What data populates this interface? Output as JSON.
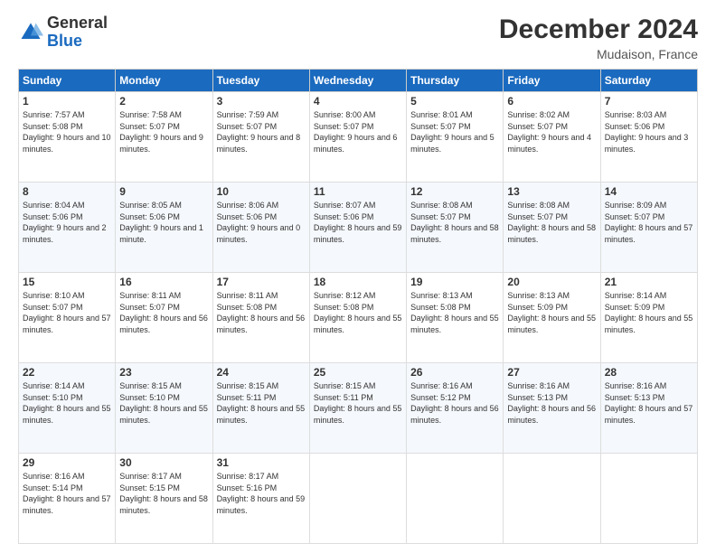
{
  "logo": {
    "general": "General",
    "blue": "Blue"
  },
  "title": "December 2024",
  "location": "Mudaison, France",
  "weekdays": [
    "Sunday",
    "Monday",
    "Tuesday",
    "Wednesday",
    "Thursday",
    "Friday",
    "Saturday"
  ],
  "weeks": [
    [
      {
        "day": "1",
        "sunrise": "7:57 AM",
        "sunset": "5:08 PM",
        "daylight": "9 hours and 10 minutes."
      },
      {
        "day": "2",
        "sunrise": "7:58 AM",
        "sunset": "5:07 PM",
        "daylight": "9 hours and 9 minutes."
      },
      {
        "day": "3",
        "sunrise": "7:59 AM",
        "sunset": "5:07 PM",
        "daylight": "9 hours and 8 minutes."
      },
      {
        "day": "4",
        "sunrise": "8:00 AM",
        "sunset": "5:07 PM",
        "daylight": "9 hours and 6 minutes."
      },
      {
        "day": "5",
        "sunrise": "8:01 AM",
        "sunset": "5:07 PM",
        "daylight": "9 hours and 5 minutes."
      },
      {
        "day": "6",
        "sunrise": "8:02 AM",
        "sunset": "5:07 PM",
        "daylight": "9 hours and 4 minutes."
      },
      {
        "day": "7",
        "sunrise": "8:03 AM",
        "sunset": "5:06 PM",
        "daylight": "9 hours and 3 minutes."
      }
    ],
    [
      {
        "day": "8",
        "sunrise": "8:04 AM",
        "sunset": "5:06 PM",
        "daylight": "9 hours and 2 minutes."
      },
      {
        "day": "9",
        "sunrise": "8:05 AM",
        "sunset": "5:06 PM",
        "daylight": "9 hours and 1 minute."
      },
      {
        "day": "10",
        "sunrise": "8:06 AM",
        "sunset": "5:06 PM",
        "daylight": "9 hours and 0 minutes."
      },
      {
        "day": "11",
        "sunrise": "8:07 AM",
        "sunset": "5:06 PM",
        "daylight": "8 hours and 59 minutes."
      },
      {
        "day": "12",
        "sunrise": "8:08 AM",
        "sunset": "5:07 PM",
        "daylight": "8 hours and 58 minutes."
      },
      {
        "day": "13",
        "sunrise": "8:08 AM",
        "sunset": "5:07 PM",
        "daylight": "8 hours and 58 minutes."
      },
      {
        "day": "14",
        "sunrise": "8:09 AM",
        "sunset": "5:07 PM",
        "daylight": "8 hours and 57 minutes."
      }
    ],
    [
      {
        "day": "15",
        "sunrise": "8:10 AM",
        "sunset": "5:07 PM",
        "daylight": "8 hours and 57 minutes."
      },
      {
        "day": "16",
        "sunrise": "8:11 AM",
        "sunset": "5:07 PM",
        "daylight": "8 hours and 56 minutes."
      },
      {
        "day": "17",
        "sunrise": "8:11 AM",
        "sunset": "5:08 PM",
        "daylight": "8 hours and 56 minutes."
      },
      {
        "day": "18",
        "sunrise": "8:12 AM",
        "sunset": "5:08 PM",
        "daylight": "8 hours and 55 minutes."
      },
      {
        "day": "19",
        "sunrise": "8:13 AM",
        "sunset": "5:08 PM",
        "daylight": "8 hours and 55 minutes."
      },
      {
        "day": "20",
        "sunrise": "8:13 AM",
        "sunset": "5:09 PM",
        "daylight": "8 hours and 55 minutes."
      },
      {
        "day": "21",
        "sunrise": "8:14 AM",
        "sunset": "5:09 PM",
        "daylight": "8 hours and 55 minutes."
      }
    ],
    [
      {
        "day": "22",
        "sunrise": "8:14 AM",
        "sunset": "5:10 PM",
        "daylight": "8 hours and 55 minutes."
      },
      {
        "day": "23",
        "sunrise": "8:15 AM",
        "sunset": "5:10 PM",
        "daylight": "8 hours and 55 minutes."
      },
      {
        "day": "24",
        "sunrise": "8:15 AM",
        "sunset": "5:11 PM",
        "daylight": "8 hours and 55 minutes."
      },
      {
        "day": "25",
        "sunrise": "8:15 AM",
        "sunset": "5:11 PM",
        "daylight": "8 hours and 55 minutes."
      },
      {
        "day": "26",
        "sunrise": "8:16 AM",
        "sunset": "5:12 PM",
        "daylight": "8 hours and 56 minutes."
      },
      {
        "day": "27",
        "sunrise": "8:16 AM",
        "sunset": "5:13 PM",
        "daylight": "8 hours and 56 minutes."
      },
      {
        "day": "28",
        "sunrise": "8:16 AM",
        "sunset": "5:13 PM",
        "daylight": "8 hours and 57 minutes."
      }
    ],
    [
      {
        "day": "29",
        "sunrise": "8:16 AM",
        "sunset": "5:14 PM",
        "daylight": "8 hours and 57 minutes."
      },
      {
        "day": "30",
        "sunrise": "8:17 AM",
        "sunset": "5:15 PM",
        "daylight": "8 hours and 58 minutes."
      },
      {
        "day": "31",
        "sunrise": "8:17 AM",
        "sunset": "5:16 PM",
        "daylight": "8 hours and 59 minutes."
      },
      null,
      null,
      null,
      null
    ]
  ]
}
